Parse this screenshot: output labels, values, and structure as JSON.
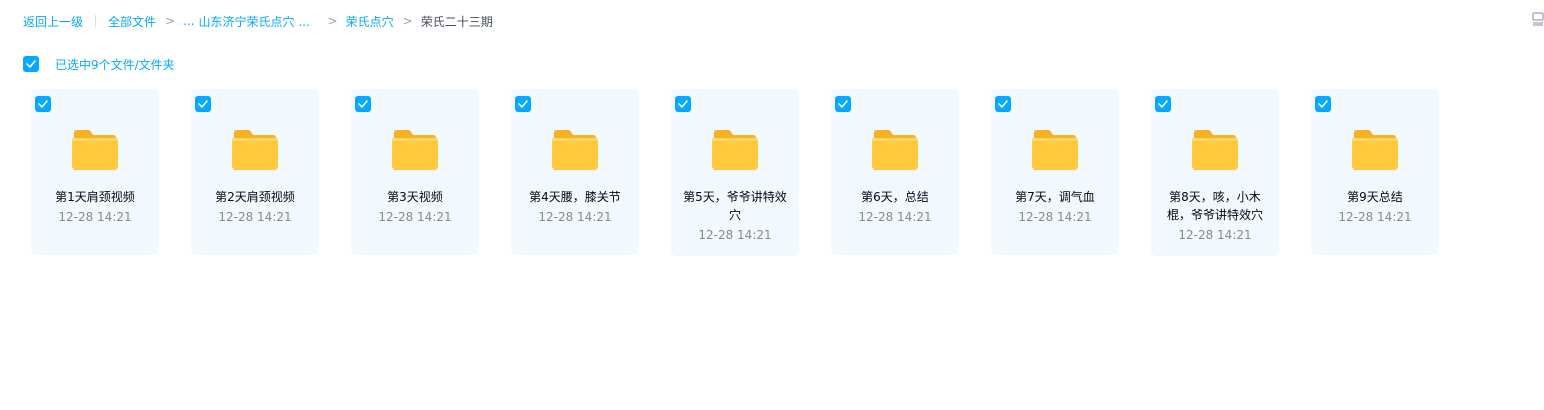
{
  "breadcrumb": {
    "back": "返回上一级",
    "all_files": "全部文件",
    "sep": ">",
    "ellipsis": "...",
    "level3": "山东济宁荣氏点穴 ...",
    "level4": "荣氏点穴",
    "current": "荣氏二十三期"
  },
  "selection": {
    "label": "已选中9个文件/文件夹"
  },
  "colors": {
    "accent": "#06a7ff",
    "tile_bg": "#f1f9fd",
    "folder": "#ffc83d"
  },
  "files": [
    {
      "name": "第1天肩颈视频",
      "time": "12-28 14:21"
    },
    {
      "name": "第2天肩颈视频",
      "time": "12-28 14:21"
    },
    {
      "name": "第3天视频",
      "time": "12-28 14:21"
    },
    {
      "name": "第4天腰，膝关节",
      "time": "12-28 14:21"
    },
    {
      "name": "第5天，爷爷讲特效穴",
      "time": "12-28 14:21"
    },
    {
      "name": "第6天，总结",
      "time": "12-28 14:21"
    },
    {
      "name": "第7天，调气血",
      "time": "12-28 14:21"
    },
    {
      "name": "第8天，咳，小木棍，爷爷讲特效穴",
      "time": "12-28 14:21"
    },
    {
      "name": "第9天总结",
      "time": "12-28 14:21"
    }
  ]
}
